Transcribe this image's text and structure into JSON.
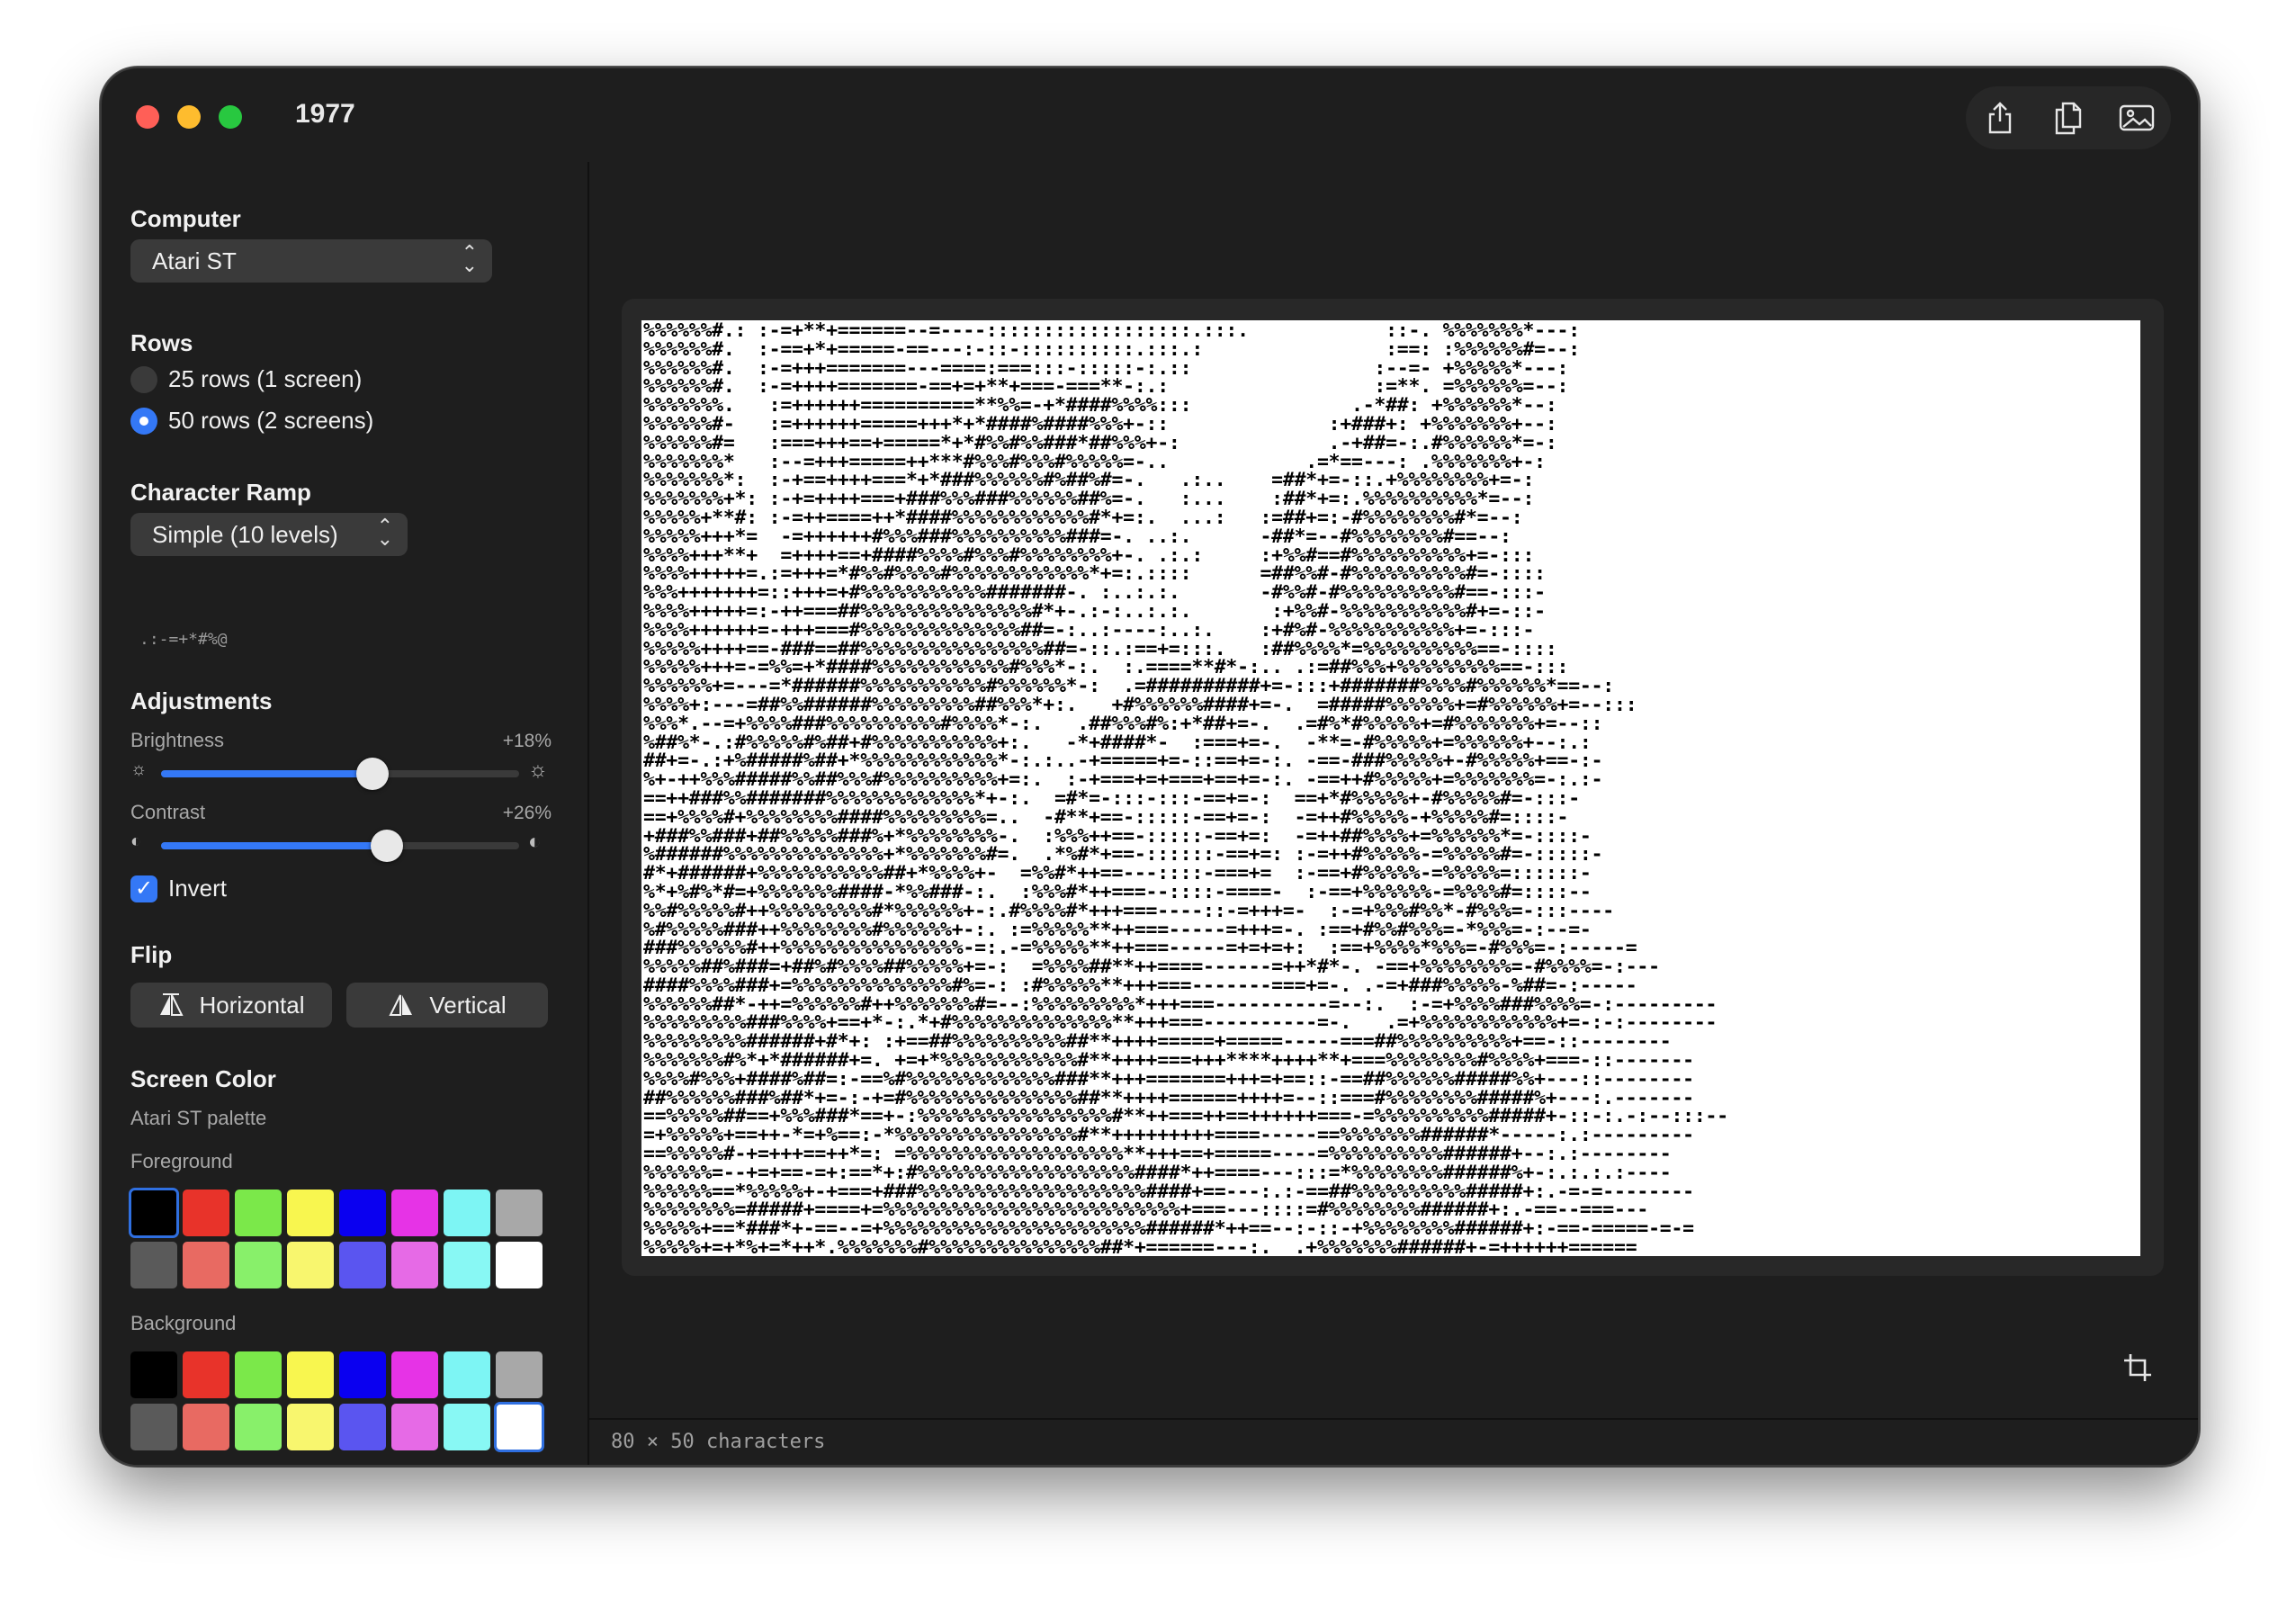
{
  "window": {
    "title": "1977"
  },
  "toolbar": {
    "icons": [
      "share-icon",
      "copy-icon",
      "save-image-icon"
    ]
  },
  "sidebar": {
    "computer": {
      "label": "Computer",
      "selected": "Atari ST"
    },
    "rows": {
      "label": "Rows",
      "options": [
        {
          "label": "25 rows (1 screen)",
          "selected": false
        },
        {
          "label": "50 rows (2 screens)",
          "selected": true
        }
      ]
    },
    "ramp": {
      "label": "Character Ramp",
      "selected": "Simple (10 levels)",
      "chars": " .:-=+*#%@"
    },
    "adjustments": {
      "label": "Adjustments",
      "brightness": {
        "label": "Brightness",
        "value_text": "+18%",
        "fraction": 0.59
      },
      "contrast": {
        "label": "Contrast",
        "value_text": "+26%",
        "fraction": 0.63
      },
      "invert": {
        "label": "Invert",
        "checked": true
      }
    },
    "flip": {
      "label": "Flip",
      "horizontal": "Horizontal",
      "vertical": "Vertical"
    },
    "screen_color": {
      "label": "Screen Color",
      "palette_name": "Atari ST palette",
      "foreground_label": "Foreground",
      "background_label": "Background",
      "palette": [
        "#000000",
        "#e8332a",
        "#7be84a",
        "#f8f64f",
        "#0a00f0",
        "#e633e6",
        "#7df5f4",
        "#a8a8a8",
        "#5a5a5a",
        "#e86a62",
        "#88f06a",
        "#f8f66e",
        "#5a55f0",
        "#e66ae6",
        "#88f8f4",
        "#ffffff"
      ],
      "foreground_selected": 0,
      "background_selected": 15
    }
  },
  "preview": {
    "ascii_lines": [
      "%%%%%%#.: :-=+**+======--=----::::::::::::::::::.:::.            ::-. %%%%%%%*---:",
      "%%%%%%#.  :-==+*+=====-==---:-::-::::::::::.:::.:                :==: :%%%%%%#=--:",
      "%%%%%%#.  :-=+++=======---====:===:::-:::::-:.::                :--=- +%%%%%*---:",
      "%%%%%%#.  :-=++++=======-==+=+**+===-===**-:.:                  :=**. =%%%%%%=--:",
      "%%%%%%%.   :=++++++==========**%%=-+*####%%%%:::              .-*##: +%%%%%%*--:",
      "%%%%%%#-   :=++++++=====+++*+*####%####%%%+-::              :+###+: +%%%%%%%+--:",
      "%%%%%%#=   :===+++==+=====*+*#%%#%%###*##%%%+-:             .-+##=-:.#%%%%%%*=-:",
      "%%%%%%%*   :--=+++=====++***#%%%#%%%#%%%%%=-..            .=*==---: .%%%%%%%+-:",
      "%%%%%%%*:  :-+==++++===*+*###%%%%%%#%##%#=-.   .:..    =##*+=-::.+%%%%%%%%+=-:",
      "%%%%%%%+*: :-+=++++===+###%%%###%%%%%%##%=-.   :...    :##*+=:.%%%%%%%%%%*=--:",
      "%%%%%+**#: :-=++====++*####%%%%%%%%%%%%#*+=:.  ...:   :=##+=:-#%%%%%%%%#*=--:",
      "%%%%%+++*=  -=++++++#%%%###%%%%%%%%%%###=-. ..:.      -##*=--#%%%%%%%%#==--:",
      "%%%%+++**+  =++++==+####%%%%#%%%#%%%%%%%%+-. .:.:     :+%%#==#%%%%%%%%%%+=-:::",
      "%%%%+++++=.:=+++=*#%%#%%%%#%%%%%%%%%%%%*+=:.::::      =##%%#-#%%%%%%%%%%#=-::::",
      "%%%+++++++=::+++=+#%%%%%%%%%%%#######-. :..:.:.       -#%%#-#%%%%%%%%%%#==-:::-",
      "%%%%+++++=:-++===##%%%%%%%%%%%%%%%#*+-.:-:..:.:.       :+%%#-%%%%%%%%%%%#+=-::-",
      "%%%%++++++=-+++===#%%%%%%%%%%%%%%##=-:..:----:..:.    :+#%#-%%%%%%%%%%%+=-:::-",
      "%%%%%++++==-###==##%%%%%%%%%%%%%%%%##=-::.:==+=:::.   :##%%%%*=%%%%%%%%%%==-::::",
      "%%%%%+++=-=%%=+*####%%%%%%%%%%%%#%%%*-:.  :.====**#*-:.. .:=##%%%+%%%%%%%%%==-:::",
      "%%%%%%+=---=*######%%%%%%%%%%%#%%%%%%*-:  .=##########+=-:::+#######%%%%#%%%%%%*==--:",
      "%%%%+:---=##%%######%%%%%%%%%##%%%*+:.   +#%%%%%%####+=-.  =#####%%%%%%+=#%%%%%%+=--:::",
      "%%%*.--=+%%%%###%%%%%%%%%%#%%%%*-:.   .##%%%#%:+*##+=-.  .=#%*#%%%%%+=#%%%%%%%+=--::",
      "%##%*-.:#%%%%%#%##+#%%%%%%%%%%%+:.   -*+####*-  :===+=-.  -**=-#%%%%%+=%%%%%%+--:.:",
      "##+=-.:+%#####%##+*%%%%%%%%%%%%*-:.:..-+=====+=-::==+=-:. -==-###%%%%%+-#%%%%%+==-:-",
      "%+-++%%%#####%%##%%%#%%%%%%%%%%+=:.  :-+===+=+===+==+=-:. -==++#%%%%%+=%%%%%%%=-:.:-",
      "==++###%%#######%%%%%%%%%%%%%*+-:.  =#*=-:::-:::-==+=-:  ==+*#%%%%%+-#%%%%%#=-:::-",
      "==+%%%%#+%%%%%%%%####%%%%%%%%%=..  -#**+==-:::::-==+=-:  -=++#%%%%%-+%%%%%#=::::-",
      "+###%%###+##%%%%%###%+*%%%%%%%%-.  :%%%++==-:::::-==+=:  -=++##%%%%+=%%%%%%*=-::::-",
      "%######%%%%%%%%%%%%%%+*%%%%%%%#=.  .*%#*+==-::::::-==+=: :-=++#%%%%%-=%%%%%#=-:::::-",
      "#*+######+%%%%%%%%%%%##+*%%%%+-  =%%#*++==---::::-===+=  :-==+#%%%%%-=%%%%%=::::::-",
      "%*+%#%*#=+%%%%%%%####-*%%###-:.  :%%%#*++===--::::-====-  :-==+%%%%%%-=%%%%#=::::--",
      "%%#%%%%%#++%%%%%%%%%#*%%%%%%+-:.#%%%%#*+++===----::-=+++=-  :-=+%%%#%%*-#%%%=-:::----",
      "%#%%%%%###++%%%%%%%%#%%%%%%+-:. :=%%%%%**++===-----=+++=-. :==+#%%#%%%=-*%%%=-:--=-",
      "###%%%%%%#++%%%%%%%%%%%%%%%%-=:.-=%%%%%**++===-----=+=+=+:  :==+%%%%*%%%=-#%%%=-:-----=",
      "%%%%%##%###=+##%#%%%%##%%%%%+=-:  =%%%%##**++====------=++*#*-. -==+%%%%%%%%=-#%%%%=-:---",
      "####%%%%###+=%%%%%%%%%%%%%%#%=-: :#%%%%%**+++===-------===+=-. .-=+###%%%%%-%##=-:-----",
      "%%%%%%##*-++=%%%%%%#++%%%%%%%#=--:%%%%%%%%%*+++===----------=--:.  :-=+%%%%###%%%%=-:---------",
      "%%%%%%%%%###%%%%+==+*-:.*+#%%%%%%%%%%%%%%**+++===----------=-.   .=+%%%%%%%%%%%%+=-:-:--------",
      "%%%%%%%%%######+#*+: :+==##%%%%%%%%%%##**++++=====+=====-----===##%%%%%%%%%%+==-::--------",
      "%%%%%%%#%*+*######+=. +=+*%%%%%%%%%%%%#**++++===+++****++++**+===%%%%%%%%#%%%%+===-::-------",
      "%%%%#%%%+####%##=:-==%#%%%%%%%%%%%%%###**+++=======+++=+==::-==##%%%%%%#####%%+---::--------",
      "##%%%%%%###%##*+=-:-+=#%%%%%%%%%%%%%%%##**++++======++++=--::===#%%%%%%%%#####%+---:.-------",
      "==%%%%%##==+%%%###*==+-:%%%%%%%%%%%%%%%%%#**++===++==++++++===-=%%%%%%%%%%#####+-::-:.-:--:::--",
      "=+%%%%%+==++-*=+%==:-*%%%%%%%%%%%%%%%%#**+++++++++====-----==%%%%%%%######*-----:.:---------",
      "==%%%%%#-+=+++==++*=: =%%%%%%%%%%%%%%%%%%%**+++==+=====----=%%%%%%%%%%######+--:.:--------",
      "%%%%%%=--+=+==-=+:==*+:#%%%%%%%%%%%%%%%%%%%####*++====---:::=*%%%%%%%%######%+-:.:.:.:----",
      "%%%%%%==*%%%%%+-+===+###%%%%%%%%%%%%%%%%%%%%####+==---:.:-==##%%%%%%%%%%#####+:.-=-=--------",
      "%%%%%%%%=#####+====+=%%%%%%%%%%%%%%%%%%%%%%%%%%+===---::::=#%%%%%%%%######+:.-==--===---",
      "%%%%%+==*###*+-==--=+%%%%%%%%%%%%%%%%%%%%%%%######*++==--:-::-+%%%%%%%%######+:-==-=====-=-=",
      "%%%%%+=+*%+=*++*.%%%%%%%#%%%%%%%%%%%%%%%##*+======---:.  .+%%%%%%%######+-=++++++======"
    ]
  },
  "status": {
    "text": "80 × 50 characters"
  }
}
